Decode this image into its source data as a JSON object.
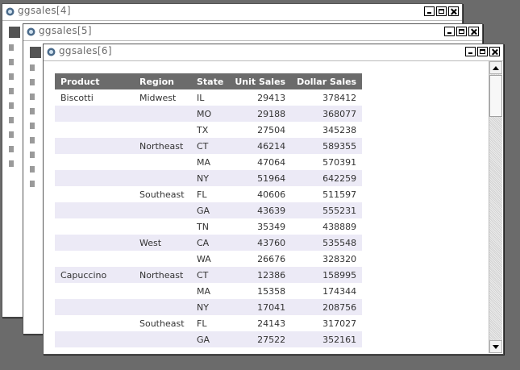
{
  "windows": [
    {
      "title": "ggsales[4]"
    },
    {
      "title": "ggsales[5]"
    },
    {
      "title": "ggsales[6]"
    }
  ],
  "table": {
    "columns": [
      "Product",
      "Region",
      "State",
      "Unit Sales",
      "Dollar Sales"
    ],
    "rows": [
      [
        "Biscotti",
        "Midwest",
        "IL",
        "29413",
        "378412"
      ],
      [
        "",
        "",
        "MO",
        "29188",
        "368077"
      ],
      [
        "",
        "",
        "TX",
        "27504",
        "345238"
      ],
      [
        "",
        "Northeast",
        "CT",
        "46214",
        "589355"
      ],
      [
        "",
        "",
        "MA",
        "47064",
        "570391"
      ],
      [
        "",
        "",
        "NY",
        "51964",
        "642259"
      ],
      [
        "",
        "Southeast",
        "FL",
        "40606",
        "511597"
      ],
      [
        "",
        "",
        "GA",
        "43639",
        "555231"
      ],
      [
        "",
        "",
        "TN",
        "35349",
        "438889"
      ],
      [
        "",
        "West",
        "CA",
        "43760",
        "535548"
      ],
      [
        "",
        "",
        "WA",
        "26676",
        "328320"
      ],
      [
        "Capuccino",
        "Northeast",
        "CT",
        "12386",
        "158995"
      ],
      [
        "",
        "",
        "MA",
        "15358",
        "174344"
      ],
      [
        "",
        "",
        "NY",
        "17041",
        "208756"
      ],
      [
        "",
        "Southeast",
        "FL",
        "24143",
        "317027"
      ],
      [
        "",
        "",
        "GA",
        "27522",
        "352161"
      ]
    ]
  }
}
